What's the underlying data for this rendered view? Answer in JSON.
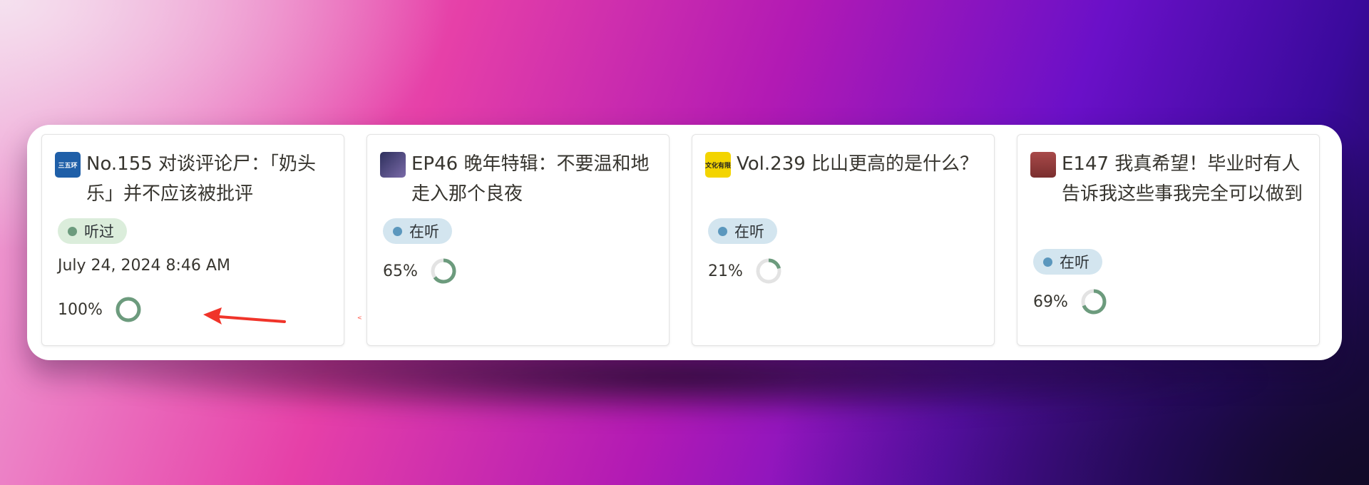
{
  "cards": [
    {
      "title": "No.155 对谈评论尸：「奶头乐」并不应该被批评",
      "cover_label": "三五环",
      "cover_color": "#1f5fa8",
      "status": "听过",
      "date": "July 24, 2024 8:46 AM",
      "progress_label": "100%",
      "progress_value": 1.0
    },
    {
      "title": "EP46 晚年特辑：不要温和地走入那个良夜",
      "cover_label": "",
      "cover_color": "#3a3f6e",
      "status": "在听",
      "progress_label": "65%",
      "progress_value": 0.65
    },
    {
      "title": "Vol.239 比山更高的是什么？",
      "cover_label": "文化有限",
      "cover_color": "#f3d400",
      "status": "在听",
      "progress_label": "21%",
      "progress_value": 0.21
    },
    {
      "title": "E147 我真希望！毕业时有人告诉我这些事我完全可以做到",
      "cover_label": "",
      "cover_color": "#8f3a3a",
      "status": "在听",
      "progress_label": "69%",
      "progress_value": 0.69
    }
  ],
  "colors": {
    "ring_fill": "#6c9b7d",
    "ring_track": "#e3e3e3",
    "arrow": "#f0342a"
  },
  "icons": {
    "annotation": "arrow-left-icon"
  }
}
